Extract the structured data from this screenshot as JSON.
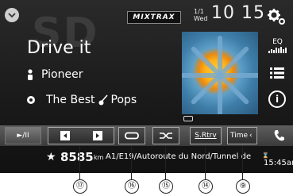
{
  "header": {
    "watermark": "SD",
    "mixtrax_label": "MIXTRAX",
    "date_top": "1/1",
    "date_bottom": "Wed",
    "time": "10 15"
  },
  "track": {
    "title": "Drive it",
    "artist": "Pioneer",
    "album_prefix": "The Best",
    "album_suffix": "Pops"
  },
  "side_icons": {
    "eq_label": "EQ"
  },
  "controls": {
    "play_pause": "►/II",
    "srtrv_label": "S.Rtrv",
    "time_label": "Time"
  },
  "navigation": {
    "distance": "8585",
    "unit": "km",
    "road": "A1/E19/Autoroute du Nord/Tunnel de",
    "eta": "15:45am"
  },
  "callouts": [
    "⑰",
    "⑯",
    "⑮",
    "⑭",
    "⑨"
  ],
  "colors": {
    "screen_bg": "#1b1b1b",
    "bar_bg": "#4a4a4a",
    "text": "#ffffff"
  }
}
